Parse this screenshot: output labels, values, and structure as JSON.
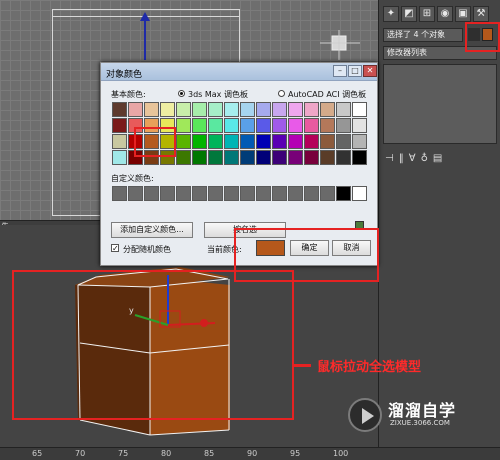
{
  "viewport": {
    "label": "先"
  },
  "right_panel": {
    "tabs": [
      "create-icon",
      "modify-icon",
      "hierarchy-icon",
      "motion-icon",
      "display-icon",
      "utilities-icon"
    ],
    "selection_text": "选择了 4 个对象",
    "modifier_list": "修改器列表",
    "object_color": "#b5581b"
  },
  "dialog": {
    "title": "对象颜色",
    "basic_colors_label": "基本颜色:",
    "radio_3dsmax": "3ds Max 调色板",
    "radio_autocad": "AutoCAD ACI 调色板",
    "custom_colors_label": "自定义颜色:",
    "add_custom_button": "添加自定义颜色...",
    "select_button": "按名选",
    "random_checkbox_label": "分配随机颜色",
    "random_checked": true,
    "current_color_label": "当前颜色:",
    "current_color": "#b5581b",
    "ok_button": "确定",
    "cancel_button": "取消",
    "palette_colors": [
      "#5e3a2e",
      "#e8a6a6",
      "#e8c49a",
      "#eeeea2",
      "#c8eeaa",
      "#a6eeaa",
      "#a6eec8",
      "#a6eeee",
      "#a6d4ee",
      "#a6aaee",
      "#c8a6ee",
      "#eea6ee",
      "#eea6c8",
      "#d4aa8a",
      "#c8c8c8",
      "#ffffff",
      "#7a1a1a",
      "#e85a5a",
      "#e8a05a",
      "#e8e85a",
      "#a0e85a",
      "#5ae85a",
      "#5ae8a0",
      "#5ae8e8",
      "#5aa0e8",
      "#5a5ae8",
      "#a05ae8",
      "#e85ae8",
      "#e85aa0",
      "#b4785a",
      "#969696",
      "#e2e2e2",
      "#c8c8a0",
      "#b40000",
      "#b45a1e",
      "#b4b400",
      "#5ab400",
      "#00b400",
      "#00b45a",
      "#00b4b4",
      "#005ab4",
      "#0000b4",
      "#5a00b4",
      "#b400b4",
      "#b4005a",
      "#8c5a3c",
      "#646464",
      "#b4b4b4",
      "#a0e8e8",
      "#780000",
      "#7a3c14",
      "#787800",
      "#3c7800",
      "#007800",
      "#00783c",
      "#007878",
      "#003c78",
      "#000078",
      "#3c0078",
      "#780078",
      "#78003c",
      "#5a3c28",
      "#323232",
      "#000000"
    ],
    "custom_colors": [
      "#6a6a6a",
      "#6a6a6a",
      "#6a6a6a",
      "#6a6a6a",
      "#6a6a6a",
      "#6a6a6a",
      "#6a6a6a",
      "#6a6a6a",
      "#6a6a6a",
      "#6a6a6a",
      "#6a6a6a",
      "#6a6a6a",
      "#6a6a6a",
      "#6a6a6a",
      "#000000",
      "#ffffff"
    ]
  },
  "annotation": {
    "text": "鼠标拉动全选模型"
  },
  "watermark": {
    "text": "溜溜自学",
    "url": "ZIXUE.3066.COM"
  },
  "timeline": {
    "ticks": [
      "65",
      "70",
      "75",
      "80",
      "85",
      "90",
      "95",
      "100"
    ]
  }
}
